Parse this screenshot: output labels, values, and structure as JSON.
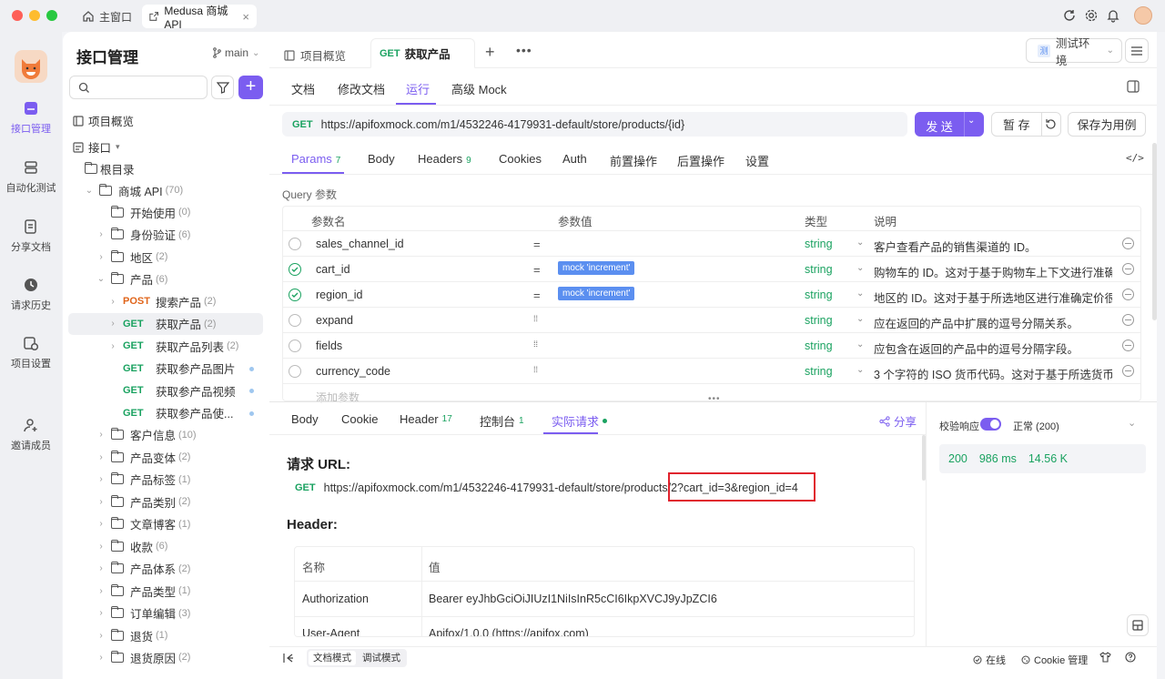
{
  "titlebar": {
    "home_tab": "主窗口",
    "active_tab": "Medusa 商城 API"
  },
  "rail": {
    "items": [
      {
        "label": "接口管理",
        "icon": "api-icon",
        "active": true
      },
      {
        "label": "自动化测试",
        "icon": "automation-icon",
        "active": false
      },
      {
        "label": "分享文档",
        "icon": "share-doc-icon",
        "active": false
      },
      {
        "label": "请求历史",
        "icon": "history-icon",
        "active": false
      },
      {
        "label": "项目设置",
        "icon": "settings-icon",
        "active": false
      },
      {
        "label": "邀请成员",
        "icon": "invite-icon",
        "active": false
      }
    ]
  },
  "sidebar": {
    "title": "接口管理",
    "branch": "main",
    "overview": "项目概览",
    "api_label": "接口",
    "root": "根目录",
    "tree": [
      {
        "type": "folder",
        "indent": 1,
        "chevron": "⌄",
        "label": "商城 API",
        "count": "(70)"
      },
      {
        "type": "folder",
        "indent": 2,
        "chevron": "",
        "label": "开始使用",
        "count": "(0)"
      },
      {
        "type": "folder",
        "indent": 2,
        "chevron": "›",
        "label": "身份验证",
        "count": "(6)"
      },
      {
        "type": "folder",
        "indent": 2,
        "chevron": "›",
        "label": "地区",
        "count": "(2)"
      },
      {
        "type": "folder",
        "indent": 2,
        "chevron": "⌄",
        "label": "产品",
        "count": "(6)"
      },
      {
        "type": "api",
        "indent": 3,
        "chevron": "›",
        "method": "POST",
        "label": "搜索产品",
        "count": "(2)"
      },
      {
        "type": "api",
        "indent": 3,
        "chevron": "›",
        "method": "GET",
        "label": "获取产品",
        "count": "(2)",
        "selected": true
      },
      {
        "type": "api",
        "indent": 3,
        "chevron": "›",
        "method": "GET",
        "label": "获取产品列表",
        "count": "(2)"
      },
      {
        "type": "api",
        "indent": 3,
        "chevron": "",
        "method": "GET",
        "label": "获取参产品图片",
        "count": "",
        "dot": true
      },
      {
        "type": "api",
        "indent": 3,
        "chevron": "",
        "method": "GET",
        "label": "获取参产品视频",
        "count": "",
        "dot": true
      },
      {
        "type": "api",
        "indent": 3,
        "chevron": "",
        "method": "GET",
        "label": "获取参产品使...",
        "count": "",
        "dot": true
      },
      {
        "type": "folder",
        "indent": 2,
        "chevron": "›",
        "label": "客户信息",
        "count": "(10)"
      },
      {
        "type": "folder",
        "indent": 2,
        "chevron": "›",
        "label": "产品变体",
        "count": "(2)"
      },
      {
        "type": "folder",
        "indent": 2,
        "chevron": "›",
        "label": "产品标签",
        "count": "(1)"
      },
      {
        "type": "folder",
        "indent": 2,
        "chevron": "›",
        "label": "产品类别",
        "count": "(2)"
      },
      {
        "type": "folder",
        "indent": 2,
        "chevron": "›",
        "label": "文章博客",
        "count": "(1)"
      },
      {
        "type": "folder",
        "indent": 2,
        "chevron": "›",
        "label": "收款",
        "count": "(6)"
      },
      {
        "type": "folder",
        "indent": 2,
        "chevron": "›",
        "label": "产品体系",
        "count": "(2)"
      },
      {
        "type": "folder",
        "indent": 2,
        "chevron": "›",
        "label": "产品类型",
        "count": "(1)"
      },
      {
        "type": "folder",
        "indent": 2,
        "chevron": "›",
        "label": "订单编辑",
        "count": "(3)"
      },
      {
        "type": "folder",
        "indent": 2,
        "chevron": "›",
        "label": "退货",
        "count": "(1)"
      },
      {
        "type": "folder",
        "indent": 2,
        "chevron": "›",
        "label": "退货原因",
        "count": "(2)"
      }
    ]
  },
  "tabs": {
    "overview": "项目概览",
    "active_method": "GET",
    "active_label": "获取产品",
    "env": "测试环境",
    "env_badge": "测"
  },
  "subtabs": [
    "文档",
    "修改文档",
    "运行",
    "高级 Mock"
  ],
  "request": {
    "method": "GET",
    "url": "https://apifoxmock.com/m1/4532246-4179931-default/store/products/{id}",
    "send": "发 送",
    "save_temp": "暂 存",
    "save_case": "保存为用例"
  },
  "param_tabs": [
    {
      "label": "Params",
      "badge": "7"
    },
    {
      "label": "Body",
      "badge": ""
    },
    {
      "label": "Headers",
      "badge": "9"
    },
    {
      "label": "Cookies",
      "badge": ""
    },
    {
      "label": "Auth",
      "badge": ""
    },
    {
      "label": "前置操作",
      "badge": ""
    },
    {
      "label": "后置操作",
      "badge": ""
    },
    {
      "label": "设置",
      "badge": ""
    }
  ],
  "query": {
    "title": "Query 参数",
    "headers": {
      "name": "参数名",
      "value": "参数值",
      "type": "类型",
      "desc": "说明"
    },
    "rows": [
      {
        "name": "sales_channel_id",
        "checked": false,
        "eq": "=",
        "value": "",
        "type": "string",
        "desc": "客户查看产品的销售渠道的 ID。"
      },
      {
        "name": "cart_id",
        "checked": true,
        "eq": "=",
        "value": "mock 'increment'",
        "type": "string",
        "desc": "购物车的 ID。这对于基于购物车上下文进行准确"
      },
      {
        "name": "region_id",
        "checked": true,
        "eq": "=",
        "value": "mock 'increment'",
        "type": "string",
        "desc": "地区的 ID。这对于基于所选地区进行准确定价很"
      },
      {
        "name": "expand",
        "checked": false,
        "eq": "⁞⁞",
        "value": "",
        "type": "string",
        "desc": "应在返回的产品中扩展的逗号分隔关系。"
      },
      {
        "name": "fields",
        "checked": false,
        "eq": "⁞⁞",
        "value": "",
        "type": "string",
        "desc": "应包含在返回的产品中的逗号分隔字段。"
      },
      {
        "name": "currency_code",
        "checked": false,
        "eq": "⁞⁞",
        "value": "",
        "type": "string",
        "desc": "3 个字符的 ISO 货币代码。这对于基于所选货币进"
      }
    ],
    "add_placeholder": "添加参数"
  },
  "response_tabs": [
    {
      "label": "Body",
      "badge": ""
    },
    {
      "label": "Cookie",
      "badge": ""
    },
    {
      "label": "Header",
      "badge": "17"
    },
    {
      "label": "控制台",
      "badge": "1"
    },
    {
      "label": "实际请求",
      "badge": ""
    }
  ],
  "share": "分享",
  "actual": {
    "url_title": "请求 URL:",
    "method": "GET",
    "url_base": "https://apifoxmock.com/m1/4532246-4179931-default/store/products/2",
    "url_query": "?cart_id=3&region_id=4",
    "header_title": "Header:",
    "col_name": "名称",
    "col_value": "值",
    "rows": [
      {
        "name": "Authorization",
        "value": "Bearer eyJhbGciOiJIUzI1NiIsInR5cCI6IkpXVCJ9yJpZCI6"
      },
      {
        "name": "User-Agent",
        "value": "Apifox/1.0.0 (https://apifox.com)"
      }
    ]
  },
  "verify": {
    "label": "校验响应",
    "status": "正常 (200)",
    "code": "200",
    "time": "986 ms",
    "size": "14.56 K"
  },
  "footer": {
    "doc_mode": "文档模式",
    "debug_mode": "调试模式",
    "online": "在线",
    "cookie": "Cookie 管理"
  },
  "colors": {
    "accent": "#7b5df0",
    "get": "#1aa260",
    "post": "#e0651b",
    "highlight": "#e0222d"
  }
}
